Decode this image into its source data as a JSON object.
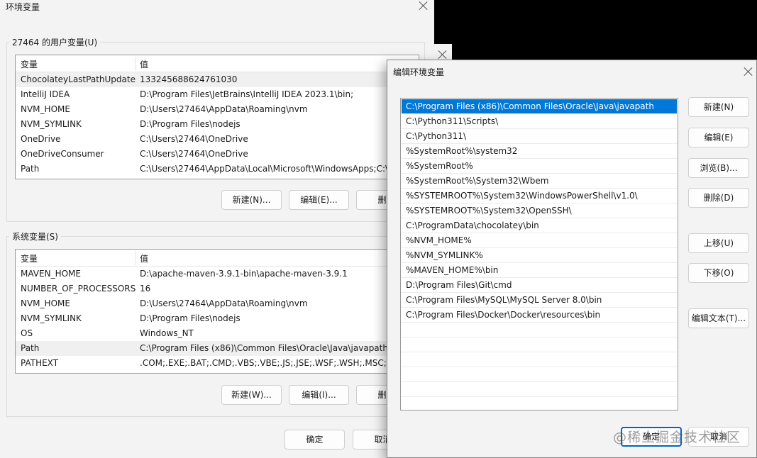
{
  "env_dialog": {
    "title": "环境变量",
    "user_vars": {
      "group_label": "27464 的用户变量(U)",
      "headers": [
        "变量",
        "值"
      ],
      "rows": [
        {
          "name": "ChocolateyLastPathUpdate",
          "value": "133245688624761030"
        },
        {
          "name": "IntelliJ IDEA",
          "value": "D:\\Program Files\\JetBrains\\IntelliJ IDEA 2023.1\\bin;"
        },
        {
          "name": "NVM_HOME",
          "value": "D:\\Users\\27464\\AppData\\Roaming\\nvm"
        },
        {
          "name": "NVM_SYMLINK",
          "value": "D:\\Program Files\\nodejs"
        },
        {
          "name": "OneDrive",
          "value": "C:\\Users\\27464\\OneDrive"
        },
        {
          "name": "OneDriveConsumer",
          "value": "C:\\Users\\27464\\OneDrive"
        },
        {
          "name": "Path",
          "value": "C:\\Users\\27464\\AppData\\Local\\Microsoft\\WindowsApps;C:\\"
        }
      ],
      "buttons": {
        "new": "新建(N)...",
        "edit": "编辑(E)...",
        "delete": "删除"
      }
    },
    "system_vars": {
      "group_label": "系统变量(S)",
      "headers": [
        "变量",
        "值"
      ],
      "rows": [
        {
          "name": "MAVEN_HOME",
          "value": "D:\\apache-maven-3.9.1-bin\\apache-maven-3.9.1"
        },
        {
          "name": "NUMBER_OF_PROCESSORS",
          "value": "16"
        },
        {
          "name": "NVM_HOME",
          "value": "D:\\Users\\27464\\AppData\\Roaming\\nvm"
        },
        {
          "name": "NVM_SYMLINK",
          "value": "D:\\Program Files\\nodejs"
        },
        {
          "name": "OS",
          "value": "Windows_NT"
        },
        {
          "name": "Path",
          "value": "C:\\Program Files (x86)\\Common Files\\Oracle\\Java\\javapath;C"
        },
        {
          "name": "PATHEXT",
          "value": ".COM;.EXE;.BAT;.CMD;.VBS;.VBE;.JS;.JSE;.WSF;.WSH;.MSC;.PY;"
        }
      ],
      "buttons": {
        "new": "新建(W)...",
        "edit": "编辑(I)...",
        "delete": "删除"
      }
    },
    "ok": "确定",
    "cancel": "取消"
  },
  "edit_dialog": {
    "title": "编辑环境变量",
    "paths": [
      "C:\\Program Files (x86)\\Common Files\\Oracle\\Java\\javapath",
      "C:\\Python311\\Scripts\\",
      "C:\\Python311\\",
      "%SystemRoot%\\system32",
      "%SystemRoot%",
      "%SystemRoot%\\System32\\Wbem",
      "%SYSTEMROOT%\\System32\\WindowsPowerShell\\v1.0\\",
      "%SYSTEMROOT%\\System32\\OpenSSH\\",
      "C:\\ProgramData\\chocolatey\\bin",
      "%NVM_HOME%",
      "%NVM_SYMLINK%",
      "%MAVEN_HOME%\\bin",
      "D:\\Program Files\\Git\\cmd",
      "C:\\Program Files\\MySQL\\MySQL Server 8.0\\bin",
      "C:\\Program Files\\Docker\\Docker\\resources\\bin"
    ],
    "buttons": {
      "new": "新建(N)",
      "edit": "编辑(E)",
      "browse": "浏览(B)...",
      "delete": "删除(D)",
      "move_up": "上移(U)",
      "move_down": "下移(O)",
      "edit_text": "编辑文本(T)...",
      "ok": "确定",
      "cancel": "取消"
    },
    "watermark": "@稀土掘金技术社区"
  }
}
